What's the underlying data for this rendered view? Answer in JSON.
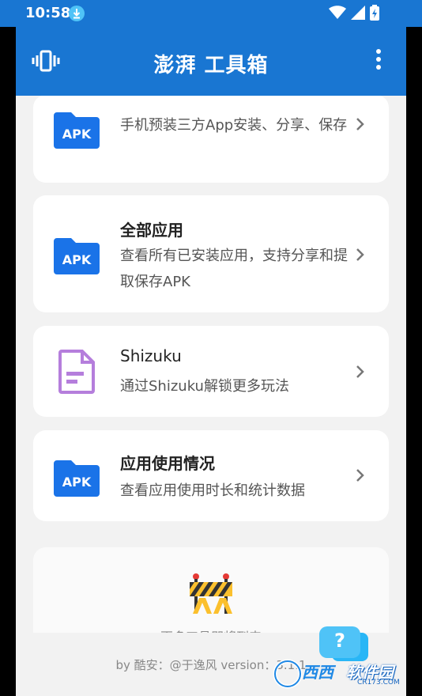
{
  "status_bar": {
    "time": "10:58"
  },
  "app_bar": {
    "title": "澎湃 工具箱"
  },
  "cards": [
    {
      "title": "",
      "desc": "手机预装三方App安装、分享、保存",
      "icon_label": "APK"
    },
    {
      "title": "全部应用",
      "desc": "查看所有已安装应用，支持分享和提取保存APK",
      "icon_label": "APK"
    },
    {
      "title": "Shizuku",
      "desc": "通过Shizuku解锁更多玩法",
      "icon_label": ""
    },
    {
      "title": "应用使用情况",
      "desc": "查看应用使用时长和统计数据",
      "icon_label": "APK"
    }
  ],
  "coming_soon": "更多工具即将到来",
  "byline": "by 酷安：@于逸风 version：3.1.1",
  "help_button": "?",
  "watermark": {
    "text_a": "西西",
    "text_b": "软件园",
    "text_c": "CR173.COM"
  },
  "colors": {
    "primary": "#1976d2",
    "apk_blue": "#1a73e8",
    "shizuku_purple": "#b57edc",
    "background": "#f2f2f2"
  }
}
